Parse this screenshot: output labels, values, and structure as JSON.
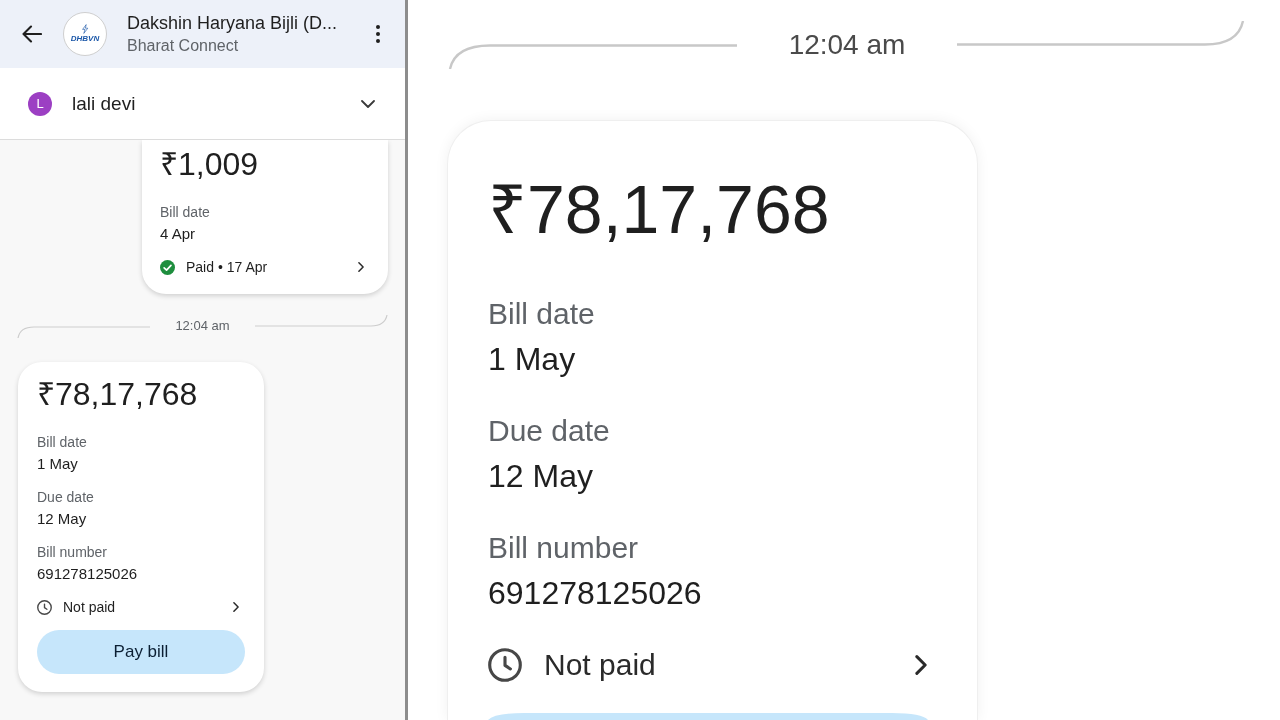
{
  "header": {
    "title": "Dakshin Haryana Bijli (D...",
    "subtitle": "Bharat Connect",
    "logo_text": "DHBVN"
  },
  "account": {
    "initial": "L",
    "name": "lali devi"
  },
  "chat": [
    {
      "kind": "bill",
      "amount": "₹1,009",
      "fields": [
        {
          "label": "Bill date",
          "value": "4 Apr"
        }
      ],
      "status": {
        "paid": true,
        "text": "Paid • 17 Apr"
      }
    },
    {
      "kind": "timestamp",
      "text": "12:04 am"
    },
    {
      "kind": "bill",
      "amount": "₹78,17,768",
      "fields": [
        {
          "label": "Bill date",
          "value": "1 May"
        },
        {
          "label": "Due date",
          "value": "12 May"
        },
        {
          "label": "Bill number",
          "value": "691278125026"
        }
      ],
      "status": {
        "paid": false,
        "text": "Not paid"
      },
      "button": "Pay bill"
    }
  ],
  "zoom_view": {
    "timestamp": "12:04 am",
    "bill": {
      "amount": "₹78,17,768",
      "fields": [
        {
          "label": "Bill date",
          "value": "1 May"
        },
        {
          "label": "Due date",
          "value": "12 May"
        },
        {
          "label": "Bill number",
          "value": "691278125026"
        }
      ],
      "status": {
        "paid": false,
        "text": "Not paid"
      }
    }
  }
}
